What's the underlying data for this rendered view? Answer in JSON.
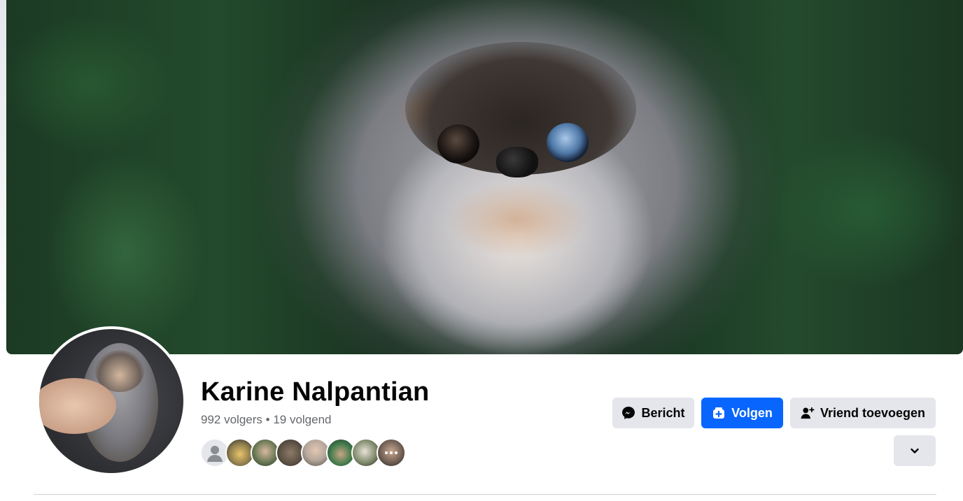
{
  "profile": {
    "name": "Karine Nalpantian",
    "followers_text": "992 volgers",
    "separator": "•",
    "following_text": "19 volgend"
  },
  "actions": {
    "message_label": "Bericht",
    "follow_label": "Volgen",
    "add_friend_label": "Vriend toevoegen"
  },
  "colors": {
    "accent": "#0866ff",
    "button_grey": "#e4e6eb",
    "secondary_text": "#65676b"
  },
  "icons": {
    "message": "messenger-icon",
    "follow": "follow-icon",
    "add_friend": "add-friend-icon",
    "more": "chevron-down-icon"
  },
  "friend_avatars": [
    {
      "icon": "default-avatar-icon"
    },
    {
      "icon": "dog-avatar"
    },
    {
      "icon": "person-avatar"
    },
    {
      "icon": "person-avatar"
    },
    {
      "icon": "person-avatar"
    },
    {
      "icon": "person-avatar"
    },
    {
      "icon": "person-avatar"
    },
    {
      "icon": "more-friends-avatar"
    }
  ]
}
